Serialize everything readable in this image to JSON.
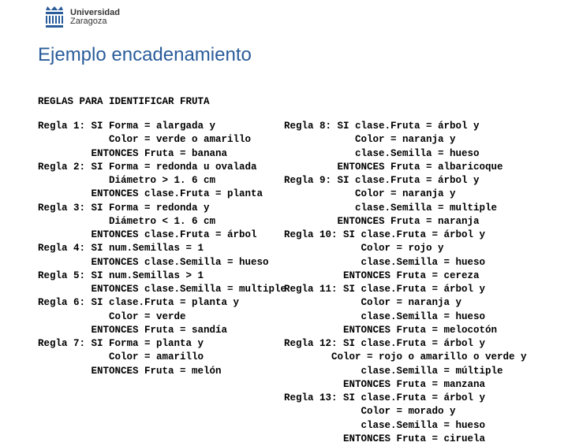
{
  "logo": {
    "line1": "Universidad",
    "line2": "Zaragoza"
  },
  "title": "Ejemplo encadenamiento",
  "rules_heading": "REGLAS PARA IDENTIFICAR FRUTA",
  "left_col": "Regla 1: SI Forma = alargada y\n            Color = verde o amarillo\n         ENTONCES Fruta = banana\nRegla 2: SI Forma = redonda u ovalada\n            Diámetro > 1. 6 cm\n         ENTONCES clase.Fruta = planta\nRegla 3: SI Forma = redonda y\n            Diámetro < 1. 6 cm\n         ENTONCES clase.Fruta = árbol\nRegla 4: SI num.Semillas = 1\n         ENTONCES clase.Semilla = hueso\nRegla 5: SI num.Semillas > 1\n         ENTONCES clase.Semilla = multiple\nRegla 6: SI clase.Fruta = planta y\n            Color = verde\n         ENTONCES Fruta = sandía\nRegla 7: SI Forma = planta y\n            Color = amarillo\n         ENTONCES Fruta = melón",
  "right_col": "Regla 8: SI clase.Fruta = árbol y\n            Color = naranja y\n            clase.Semilla = hueso\n         ENTONCES Fruta = albaricoque\nRegla 9: SI clase.Fruta = árbol y\n            Color = naranja y\n            clase.Semilla = multiple\n         ENTONCES Fruta = naranja\nRegla 10: SI clase.Fruta = árbol y\n             Color = rojo y\n             clase.Semilla = hueso\n          ENTONCES Fruta = cereza\nRegla 11: SI clase.Fruta = árbol y\n             Color = naranja y\n             clase.Semilla = hueso\n          ENTONCES Fruta = melocotón\nRegla 12: SI clase.Fruta = árbol y\n        Color = rojo o amarillo o verde y\n             clase.Semilla = múltiple\n          ENTONCES Fruta = manzana\nRegla 13: SI clase.Fruta = árbol y\n             Color = morado y\n             clase.Semilla = hueso\n          ENTONCES Fruta = ciruela"
}
